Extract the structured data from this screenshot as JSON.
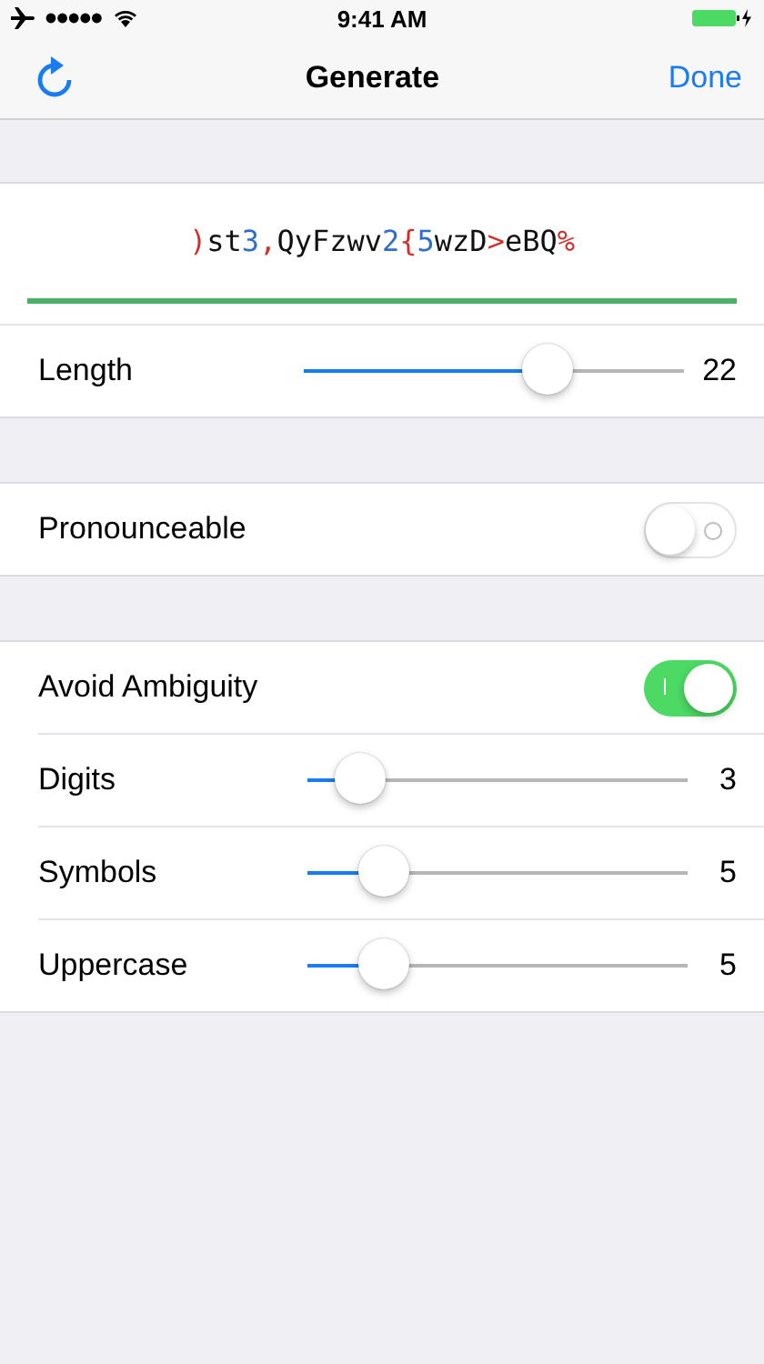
{
  "status_bar": {
    "time": "9:41 AM"
  },
  "nav_bar": {
    "title": "Generate",
    "done": "Done"
  },
  "password": {
    "segments": [
      {
        "text": ")",
        "kind": "symbol"
      },
      {
        "text": "st",
        "kind": "letter"
      },
      {
        "text": "3",
        "kind": "digit"
      },
      {
        "text": ",",
        "kind": "symbol"
      },
      {
        "text": "QyFzwv",
        "kind": "letter"
      },
      {
        "text": "2",
        "kind": "digit"
      },
      {
        "text": "{",
        "kind": "symbol"
      },
      {
        "text": "5",
        "kind": "digit"
      },
      {
        "text": "wzD",
        "kind": "letter"
      },
      {
        "text": ">",
        "kind": "symbol"
      },
      {
        "text": "eBQ",
        "kind": "letter"
      },
      {
        "text": "%",
        "kind": "symbol"
      }
    ]
  },
  "sections": [
    {
      "rows": [
        {
          "kind": "slider",
          "label": "Length",
          "level": 0.64,
          "reading": "22"
        }
      ]
    },
    {
      "rows": [
        {
          "kind": "toggle",
          "label": "Pronounceable",
          "on": false
        }
      ]
    },
    {
      "rows": [
        {
          "kind": "toggle",
          "label": "Avoid Ambiguity",
          "on": true
        },
        {
          "kind": "slider",
          "label": "Digits",
          "level": 0.14,
          "reading": "3"
        },
        {
          "kind": "slider",
          "label": "Symbols",
          "level": 0.2,
          "reading": "5"
        },
        {
          "kind": "slider",
          "label": "Uppercase",
          "level": 0.2,
          "reading": "5"
        }
      ]
    }
  ]
}
